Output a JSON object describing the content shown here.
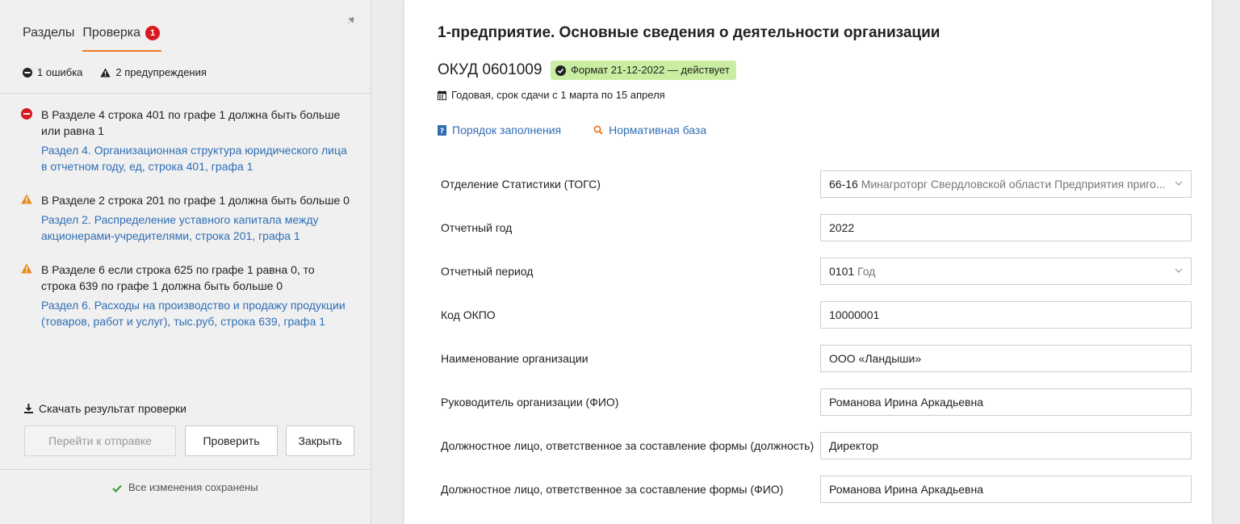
{
  "left_panel": {
    "tabs": {
      "sections": "Разделы",
      "check": "Проверка",
      "check_badge": "1"
    },
    "summary": {
      "errors": "1 ошибка",
      "warnings": "2 предупреждения"
    },
    "issues": [
      {
        "type": "error",
        "message": "В Разделе 4 строка 401 по графе 1 должна быть больше или равна 1",
        "link": "Раздел 4. Организационная структура юридического лица в отчетном году, ед, строка 401, графа 1"
      },
      {
        "type": "warning",
        "message": "В Разделе 2 строка 201 по графе 1 должна быть больше 0",
        "link": "Раздел 2. Распределение уставного капитала между акционерами-учредителями, строка 201, графа 1"
      },
      {
        "type": "warning",
        "message": "В Разделе 6 если строка 625 по графе 1 равна 0, то строка 639 по графе 1 должна быть больше 0",
        "link": "Раздел 6. Расходы на производство и продажу продукции (товаров, работ и услуг), тыс.руб, строка 639, графа 1"
      }
    ],
    "download_label": "Скачать результат проверки",
    "buttons": {
      "send": "Перейти к отправке",
      "check": "Проверить",
      "close": "Закрыть"
    },
    "saved_status": "Все изменения сохранены"
  },
  "main": {
    "title": "1-предприятие. Основные сведения о деятельности организации",
    "okud": "ОКУД 0601009",
    "format_badge": "Формат 21-12-2022 — действует",
    "period_note": "Годовая, срок сдачи с 1 марта по 15 апреля",
    "links": {
      "fill_order": "Порядок заполнения",
      "normative": "Нормативная база"
    },
    "fields": [
      {
        "label": "Отделение Статистики (ТОГС)",
        "code": "66-16",
        "name": "Минагроторг Свердловской области Предприятия приго...",
        "type": "select"
      },
      {
        "label": "Отчетный год",
        "value": "2022",
        "type": "input"
      },
      {
        "label": "Отчетный период",
        "code": "0101",
        "name": "Год",
        "type": "select"
      },
      {
        "label": "Код ОКПО",
        "value": "10000001",
        "type": "input"
      },
      {
        "label": "Наименование организации",
        "value": "ООО «Ландыши»",
        "type": "input"
      },
      {
        "label": "Руководитель организации (ФИО)",
        "value": "Романова Ирина Аркадьевна",
        "type": "input"
      },
      {
        "label": "Должностное лицо, ответственное за составление формы (должность)",
        "value": "Директор",
        "type": "input"
      },
      {
        "label": "Должностное лицо, ответственное за составление формы (ФИО)",
        "value": "Романова Ирина Аркадьевна",
        "type": "input"
      }
    ]
  },
  "colors": {
    "accent": "#f07a22",
    "error": "#d71920",
    "warning": "#e8891c",
    "link": "#2f6eb5",
    "ok_badge": "#c9eea1"
  }
}
